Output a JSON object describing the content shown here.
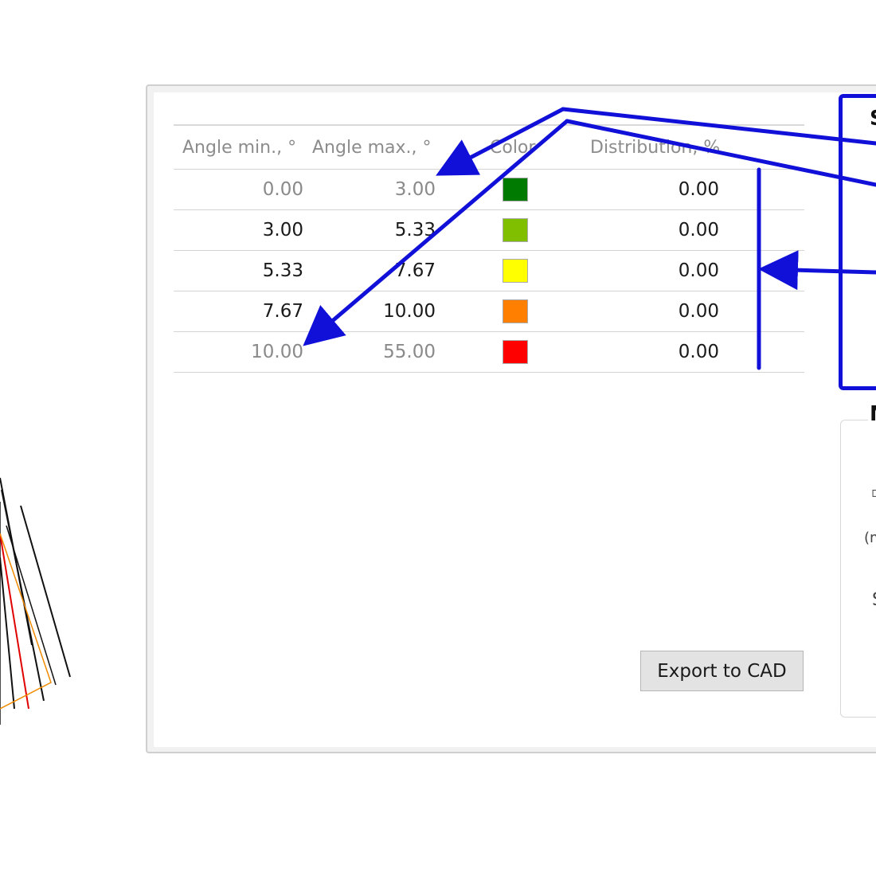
{
  "table": {
    "headers": {
      "angle_min": "Angle min., °",
      "angle_max": "Angle max., °",
      "color": "Color",
      "distribution": "Distribution, %"
    },
    "rows": [
      {
        "min": "0.00",
        "max": "3.00",
        "color": "#007a00",
        "distribution": "0.00",
        "dim_min": true,
        "dim_max": true
      },
      {
        "min": "3.00",
        "max": "5.33",
        "color": "#7fbf00",
        "distribution": "0.00",
        "dim_min": false,
        "dim_max": false
      },
      {
        "min": "5.33",
        "max": "7.67",
        "color": "#ffff00",
        "distribution": "0.00",
        "dim_min": false,
        "dim_max": false
      },
      {
        "min": "7.67",
        "max": "10.00",
        "color": "#ff7f00",
        "distribution": "0.00",
        "dim_min": false,
        "dim_max": false
      },
      {
        "min": "10.00",
        "max": "55.00",
        "color": "#ff0000",
        "distribution": "0.00",
        "dim_min": true,
        "dim_max": true
      }
    ]
  },
  "buttons": {
    "export_to_cad": "Export to CAD"
  },
  "right_panel": {
    "top_group_label": "S",
    "bottom_group_label": "M",
    "fragment_1": "(m",
    "fragment_2": "S"
  },
  "annotation_color": "#1010d8"
}
